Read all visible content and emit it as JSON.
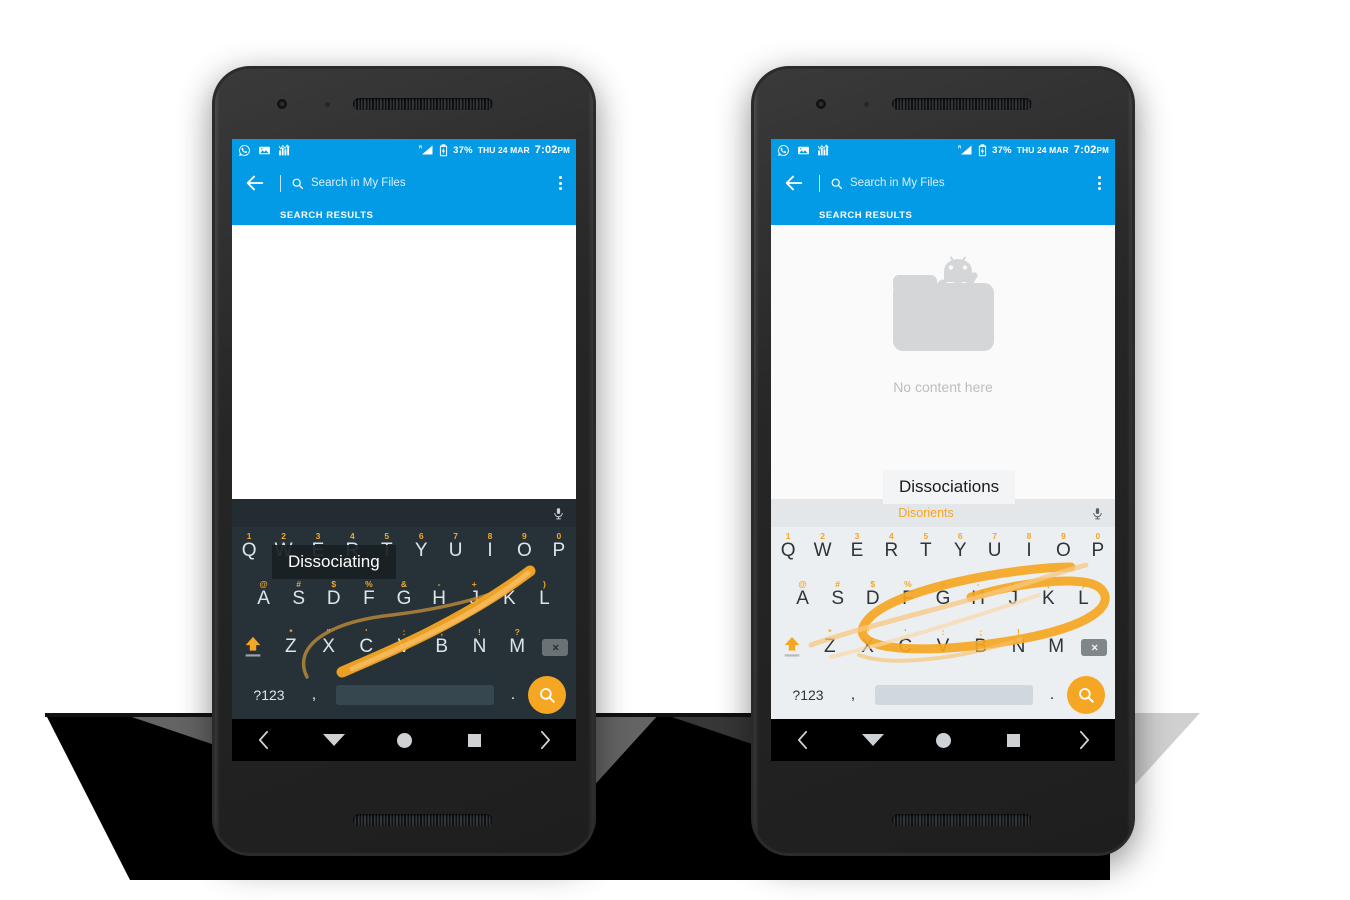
{
  "status_bar": {
    "app_icons": [
      "whatsapp-icon",
      "gallery-icon",
      "chart-icon"
    ],
    "roaming_label": "R",
    "battery_percent": "37%",
    "date": "THU 24 MAR",
    "time": "7:02",
    "ampm": "PM"
  },
  "app_bar": {
    "search_placeholder": "Search in My Files",
    "tab_label": "SEARCH RESULTS"
  },
  "colors": {
    "accent_blue": "#039BE5",
    "keyboard_orange": "#F5A623",
    "dark_keyboard_bg": "#263238",
    "light_keyboard_bg": "#ECEFF1"
  },
  "phones": [
    {
      "id": "left-phone",
      "theme": "dark",
      "content_state": "blank",
      "empty_label": "",
      "suggestion_bubble": "Dissociating",
      "suggestion_strip": [
        "",
        "",
        ""
      ]
    },
    {
      "id": "right-phone",
      "theme": "light",
      "content_state": "empty",
      "empty_label": "No content here",
      "suggestion_bubble": "Dissociations",
      "suggestion_strip": [
        "",
        "Disorients",
        ""
      ]
    }
  ],
  "keyboard": {
    "row1": [
      {
        "key": "Q",
        "hint": "1"
      },
      {
        "key": "W",
        "hint": "2"
      },
      {
        "key": "E",
        "hint": "3"
      },
      {
        "key": "R",
        "hint": "4"
      },
      {
        "key": "T",
        "hint": "5"
      },
      {
        "key": "Y",
        "hint": "6"
      },
      {
        "key": "U",
        "hint": "7"
      },
      {
        "key": "I",
        "hint": "8"
      },
      {
        "key": "O",
        "hint": "9"
      },
      {
        "key": "P",
        "hint": "0"
      }
    ],
    "row2": [
      {
        "key": "A",
        "hint": "@"
      },
      {
        "key": "S",
        "hint": "#"
      },
      {
        "key": "D",
        "hint": "$"
      },
      {
        "key": "F",
        "hint": "%"
      },
      {
        "key": "G",
        "hint": "&"
      },
      {
        "key": "H",
        "hint": "-"
      },
      {
        "key": "J",
        "hint": "+"
      },
      {
        "key": "K",
        "hint": "("
      },
      {
        "key": "L",
        "hint": ")"
      }
    ],
    "row3": [
      {
        "key": "Z",
        "hint": "*"
      },
      {
        "key": "X",
        "hint": "\""
      },
      {
        "key": "C",
        "hint": "'"
      },
      {
        "key": "V",
        "hint": ":"
      },
      {
        "key": "B",
        "hint": ";"
      },
      {
        "key": "N",
        "hint": "!"
      },
      {
        "key": "M",
        "hint": "?"
      }
    ],
    "symbols_key": "?123",
    "comma_key": ",",
    "period_key": ".",
    "space_key": "",
    "enter_action": "search"
  },
  "nav_bar": {
    "items": [
      "chevron-left",
      "hide-keyboard",
      "home",
      "recents",
      "chevron-right"
    ]
  }
}
